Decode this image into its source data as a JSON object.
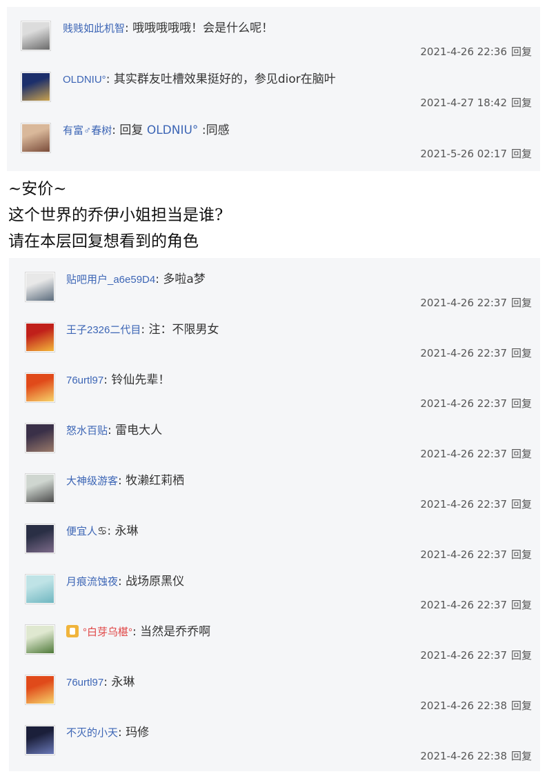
{
  "top_comments": [
    {
      "user": "贱贱如此机智",
      "text": "哦哦哦哦哦！会是什么呢！",
      "time": "2021-4-26 22:36",
      "reply": "回复",
      "avatar_colors": [
        "#dcdcdc",
        "#6a6a6a"
      ]
    },
    {
      "user": "OLDNIU°",
      "text": "其实群友吐槽效果挺好的，参见dior在脑叶",
      "time": "2021-4-27 18:42",
      "reply": "回复",
      "avatar_colors": [
        "#1c2f6b",
        "#c9a24e"
      ]
    },
    {
      "user": "有富♂春树",
      "prefix": "回复",
      "reply_to": "OLDNIU°",
      "text": ":同感",
      "time": "2021-5-26 02:17",
      "reply": "回复",
      "avatar_colors": [
        "#d9b89a",
        "#7a4c3a"
      ]
    }
  ],
  "floor": {
    "line1": "~安价~",
    "line2": "这个世界的乔伊小姐担当是谁?",
    "line3": "请在本层回复想看到的角色"
  },
  "bottom_comments": [
    {
      "user": "贴吧用户_a6e59D4",
      "text": "多啦a梦",
      "time": "2021-4-26 22:37",
      "reply": "回复",
      "avatar_colors": [
        "#e8e8e8",
        "#5a6b7c"
      ]
    },
    {
      "user": "王子2326二代目",
      "text": "注：不限男女",
      "time": "2021-4-26 22:37",
      "reply": "回复",
      "avatar_colors": [
        "#c0201a",
        "#f3b73b"
      ]
    },
    {
      "user": "76urtl97",
      "text": "铃仙先辈！",
      "time": "2021-4-26 22:37",
      "reply": "回复",
      "avatar_colors": [
        "#e04a1a",
        "#f6d36b"
      ]
    },
    {
      "user": "怒水百贴",
      "text": "雷电大人",
      "time": "2021-4-26 22:37",
      "reply": "回复",
      "avatar_colors": [
        "#3a3048",
        "#9a7a6a"
      ]
    },
    {
      "user": "大神级游客",
      "text": "牧濑红莉栖",
      "time": "2021-4-26 22:37",
      "reply": "回复",
      "avatar_colors": [
        "#cfd6d0",
        "#4b4b4b"
      ]
    },
    {
      "user": "便宜人",
      "zodiac": "♋",
      "text": "永琳",
      "time": "2021-4-26 22:37",
      "reply": "回复",
      "avatar_colors": [
        "#2a2f45",
        "#7d6b8a"
      ]
    },
    {
      "user": "月痕流蚀夜",
      "text": "战场原黑仪",
      "time": "2021-4-26 22:37",
      "reply": "回复",
      "avatar_colors": [
        "#bfe3e6",
        "#6fb6c0"
      ]
    },
    {
      "user": "°白芽乌椹°",
      "text": "当然是乔乔啊",
      "time": "2021-4-26 22:37",
      "reply": "回复",
      "avatar_colors": [
        "#dfe8d0",
        "#4f7a3a"
      ],
      "red_name": true,
      "badge": true
    },
    {
      "user": "76urtl97",
      "text": "永琳",
      "time": "2021-4-26 22:38",
      "reply": "回复",
      "avatar_colors": [
        "#e04a1a",
        "#f6d36b"
      ]
    },
    {
      "user": "不灭的小天",
      "text": "玛修",
      "time": "2021-4-26 22:38",
      "reply": "回复",
      "avatar_colors": [
        "#1b1f3a",
        "#6a79b8"
      ]
    }
  ]
}
